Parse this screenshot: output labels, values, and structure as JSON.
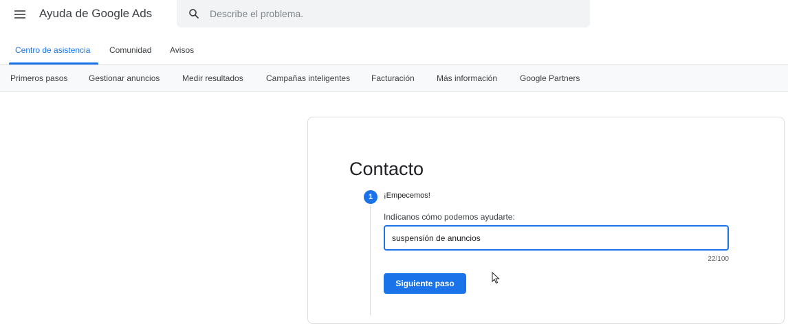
{
  "header": {
    "menu_icon": "hamburger-menu-icon",
    "title": "Ayuda de Google Ads",
    "search": {
      "icon": "search-icon",
      "placeholder": "Describe el problema.",
      "value": ""
    }
  },
  "tabs": [
    {
      "label": "Centro de asistencia",
      "active": true
    },
    {
      "label": "Comunidad",
      "active": false
    },
    {
      "label": "Avisos",
      "active": false
    }
  ],
  "subnav": {
    "items": [
      {
        "label": "Primeros pasos"
      },
      {
        "label": "Gestionar anuncios"
      },
      {
        "label": "Medir resultados"
      },
      {
        "label": "Campañas inteligentes"
      },
      {
        "label": "Facturación"
      },
      {
        "label": "Más información"
      },
      {
        "label": "Google Partners"
      }
    ]
  },
  "contact": {
    "title": "Contacto",
    "step": {
      "number": "1",
      "title": "¡Empecemos!",
      "field_label": "Indícanos cómo podemos ayudarte:",
      "field_value": "suspensión de anuncios",
      "counter": "22/100",
      "next_button": "Siguiente paso"
    }
  },
  "colors": {
    "accent": "#1a73e8",
    "search_bg": "#f1f3f4",
    "subnav_bg": "#f8f9fa",
    "border": "#dadce0"
  }
}
